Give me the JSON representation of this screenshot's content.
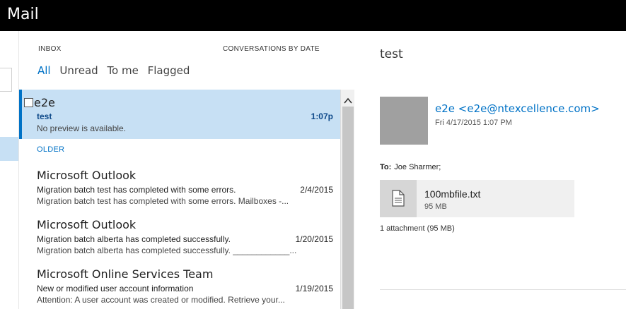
{
  "app": {
    "title": "Mail"
  },
  "list": {
    "folder_label": "INBOX",
    "sort_label": "CONVERSATIONS BY DATE",
    "filters": [
      "All",
      "Unread",
      "To me",
      "Flagged"
    ],
    "active_filter": "All",
    "items": [
      {
        "sender": "e2e",
        "subject": "test",
        "date": "1:07p",
        "preview": "No preview is available.",
        "selected": true
      }
    ],
    "group_header": "OLDER",
    "older_items": [
      {
        "sender": "Microsoft Outlook",
        "subject": "Migration batch test has completed with some errors.",
        "date": "2/4/2015",
        "preview": "Migration batch test has completed with some errors. Mailboxes -..."
      },
      {
        "sender": "Microsoft Outlook",
        "subject": "Migration batch alberta has completed successfully.",
        "date": "1/20/2015",
        "preview": "Migration batch alberta has completed successfully. ____________..."
      },
      {
        "sender": "Microsoft Online Services Team",
        "subject": "New or modified user account information",
        "date": "1/19/2015",
        "preview": "Attention: A user account was created or modified. Retrieve your..."
      }
    ]
  },
  "reading": {
    "subject": "test",
    "from": "e2e <e2e@ntexcellence.com>",
    "sent": "Fri 4/17/2015 1:07 PM",
    "to_label": "To:",
    "to_value": "Joe Sharmer;",
    "attachment": {
      "name": "100mbfile.txt",
      "size": "95 MB"
    },
    "attachment_summary": "1 attachment (95 MB)"
  },
  "icons": {
    "scroll_up": "chevron-up-icon",
    "attachment": "document-icon"
  },
  "colors": {
    "accent": "#0072c6",
    "selected_bg": "#c7e0f4"
  }
}
